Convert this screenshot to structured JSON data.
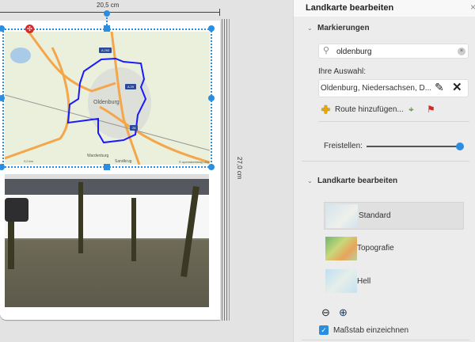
{
  "canvas": {
    "width_label": "20,5 cm",
    "height_label": "27,0 cm",
    "map_labels": {
      "shield_a293": "A 293",
      "shield_a29": "A 29",
      "shield_28": "28",
      "city": "Oldenburg",
      "town_south": "Wardenburg",
      "town_southeast": "Sandkrug",
      "attribution": "© openstreetmap.org",
      "scale": "2,0 km"
    }
  },
  "panel": {
    "title": "Landkarte bearbeiten",
    "close_label": "×",
    "markers_section": {
      "header": "Markierungen",
      "search_value": "oldenburg",
      "selection_label": "Ihre Auswahl:",
      "selection_value": "Oldenburg, Niedersachsen, D...",
      "route_label": "Route hinzufügen...",
      "crop_label": "Freistellen:",
      "crop_value_percent": 100
    },
    "map_section": {
      "header": "Landkarte bearbeiten",
      "styles": [
        {
          "label": "Standard",
          "selected": true
        },
        {
          "label": "Topografie",
          "selected": false
        },
        {
          "label": "Hell",
          "selected": false
        }
      ],
      "scale_checkbox_label": "Maßstab einzeichnen",
      "scale_checked": true
    },
    "colors": {
      "accent": "#2a8de0",
      "route": "#1a1aff"
    }
  }
}
